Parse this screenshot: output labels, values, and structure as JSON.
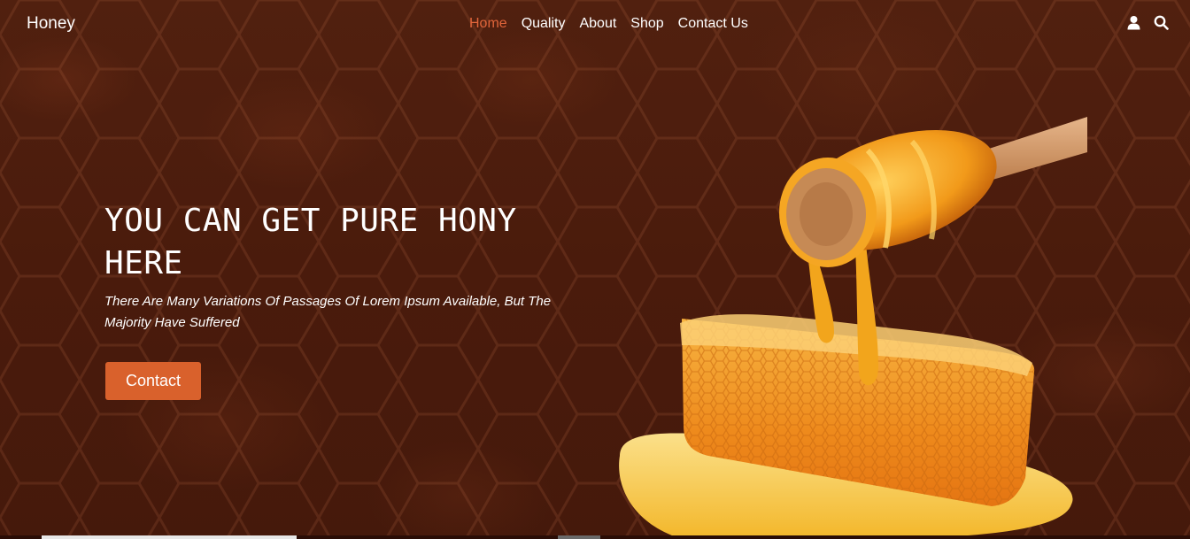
{
  "brand": {
    "name": "Honey"
  },
  "nav": {
    "items": [
      {
        "label": "Home",
        "active": true
      },
      {
        "label": "Quality",
        "active": false
      },
      {
        "label": "About",
        "active": false
      },
      {
        "label": "Shop",
        "active": false
      },
      {
        "label": "Contact Us",
        "active": false
      }
    ],
    "icons": [
      "user-icon",
      "search-icon"
    ]
  },
  "hero": {
    "headline": "YOU CAN GET PURE HONY HERE",
    "subtext": "There Are Many Variations Of Passages Of Lorem Ipsum Available, But The Majority Have Suffered",
    "button_label": "Contact"
  },
  "colors": {
    "background": "#4a1a0c",
    "accent": "#d9612c",
    "active_nav": "#e0653a",
    "text": "#ffffff"
  }
}
